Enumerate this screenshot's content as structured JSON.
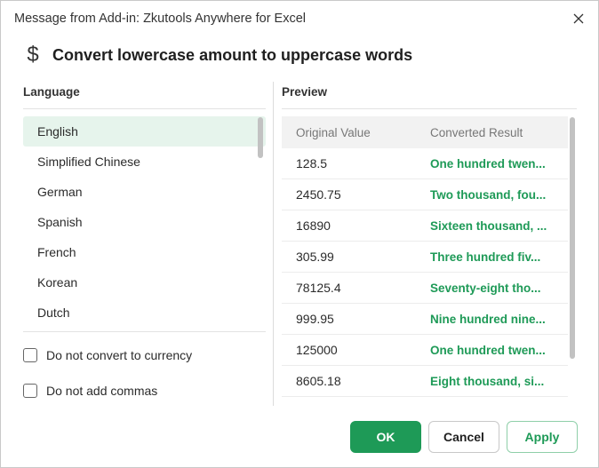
{
  "window": {
    "title": "Message from Add-in: Zkutools Anywhere for Excel",
    "close_icon": "close-icon"
  },
  "header": {
    "icon": "dollar-icon",
    "title": "Convert lowercase amount to uppercase words"
  },
  "language": {
    "label": "Language",
    "selected": "English",
    "items": [
      "English",
      "Simplified Chinese",
      "German",
      "Spanish",
      "French",
      "Korean",
      "Dutch"
    ]
  },
  "options": {
    "no_currency": {
      "label": "Do not convert to currency",
      "checked": false
    },
    "no_commas": {
      "label": "Do not add commas",
      "checked": false
    }
  },
  "preview": {
    "label": "Preview",
    "columns": [
      "Original Value",
      "Converted Result"
    ],
    "rows": [
      {
        "original": "128.5",
        "converted": "One hundred twen..."
      },
      {
        "original": "2450.75",
        "converted": "Two thousand, fou..."
      },
      {
        "original": "16890",
        "converted": "Sixteen thousand, ..."
      },
      {
        "original": "305.99",
        "converted": "Three hundred fiv..."
      },
      {
        "original": "78125.4",
        "converted": "Seventy-eight tho..."
      },
      {
        "original": "999.95",
        "converted": "Nine hundred nine..."
      },
      {
        "original": "125000",
        "converted": "One hundred twen..."
      },
      {
        "original": "8605.18",
        "converted": "Eight thousand, si..."
      }
    ]
  },
  "buttons": {
    "ok": "OK",
    "cancel": "Cancel",
    "apply": "Apply"
  },
  "colors": {
    "accent": "#1e9a57",
    "selected_bg": "#e6f4ec",
    "header_bg": "#f2f2f2"
  }
}
